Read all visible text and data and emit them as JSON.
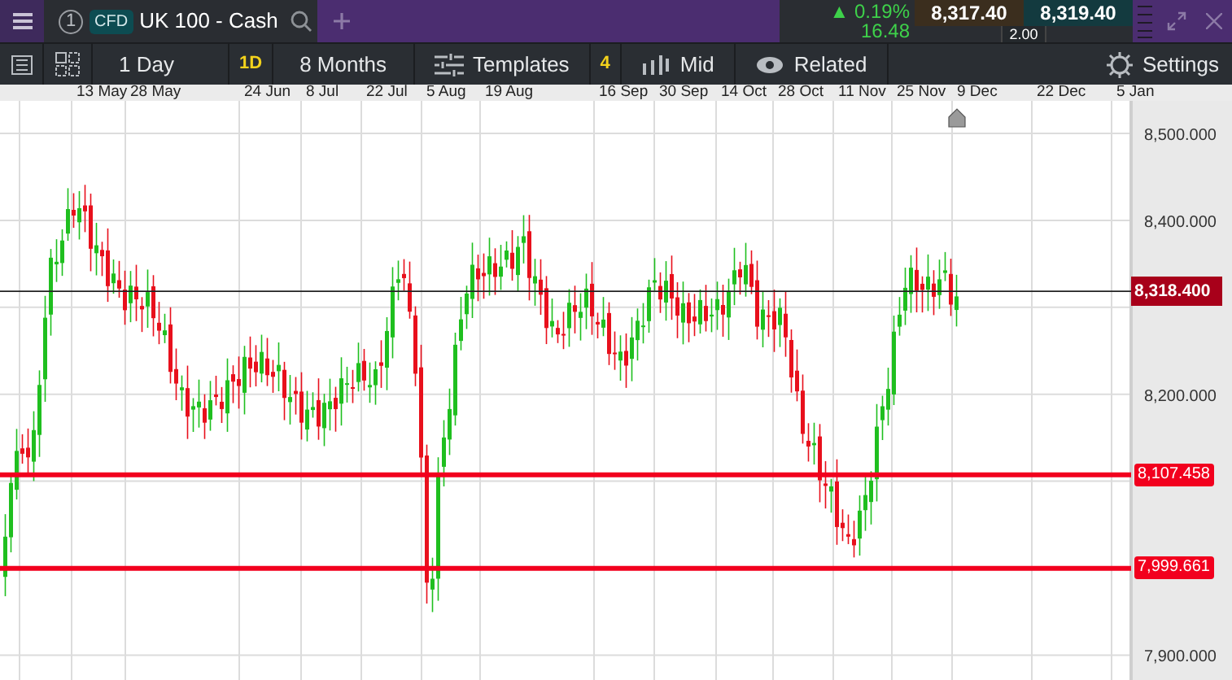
{
  "header": {
    "tab": {
      "number": "1",
      "badge": "CFD",
      "instrument": "UK 100 - Cash"
    },
    "change_percent": "▲ 0.19%",
    "change_points": "16.48",
    "sell_price": "8,317.40",
    "buy_price": "8,319.40",
    "spread": "2.00"
  },
  "toolbar": [
    {
      "kind": "list"
    },
    {
      "kind": "layout"
    },
    {
      "kind": "text",
      "label": "1 Day"
    },
    {
      "kind": "badge",
      "label": "1D"
    },
    {
      "kind": "text",
      "label": "8 Months"
    },
    {
      "kind": "templates",
      "label": "Templates"
    },
    {
      "kind": "badge",
      "label": "4"
    },
    {
      "kind": "price-type",
      "label": "Mid"
    },
    {
      "kind": "related",
      "label": "Related"
    },
    {
      "kind": "spacer"
    },
    {
      "kind": "settings",
      "label": "Settings"
    }
  ],
  "date_axis": [
    "13 May",
    "28 May",
    "24 Jun",
    "8 Jul",
    "22 Jul",
    "5 Aug",
    "19 Aug",
    "16 Sep",
    "30 Sep",
    "14 Oct",
    "28 Oct",
    "11 Nov",
    "25 Nov",
    "9 Dec",
    "22 Dec",
    "5 Jan"
  ],
  "price_axis": [
    "8,500.000",
    "8,400.000",
    "8,200.000",
    "7,900.000"
  ],
  "price_lines": [
    {
      "kind": "current",
      "label": "8,318.400"
    },
    {
      "kind": "level",
      "label": "8,107.458"
    },
    {
      "kind": "level",
      "label": "7,999.661"
    }
  ]
}
